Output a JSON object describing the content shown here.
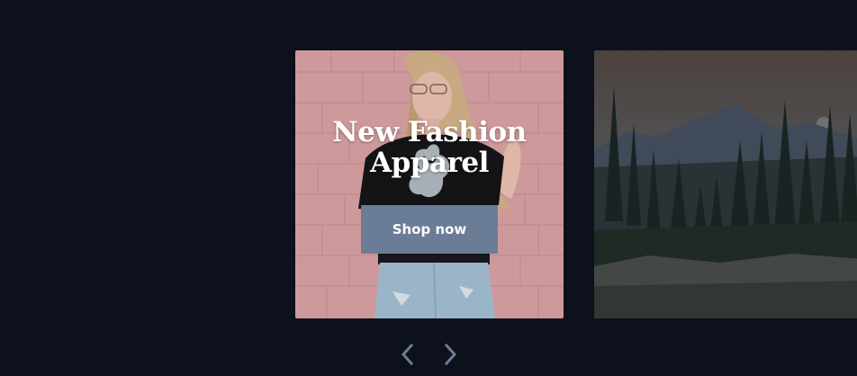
{
  "carousel": {
    "slides": [
      {
        "title_line1": "New Fashion",
        "title_line2": "Apparel",
        "button_label": "Shop now"
      },
      {
        "title_line1": "",
        "title_line2": "",
        "button_label": ""
      }
    ],
    "controls": {
      "prev_icon": "chevron-left-icon",
      "next_icon": "chevron-right-icon"
    }
  },
  "colors": {
    "background": "#0d111b",
    "button": "#6b7c96",
    "chevron": "#6b7c96"
  }
}
